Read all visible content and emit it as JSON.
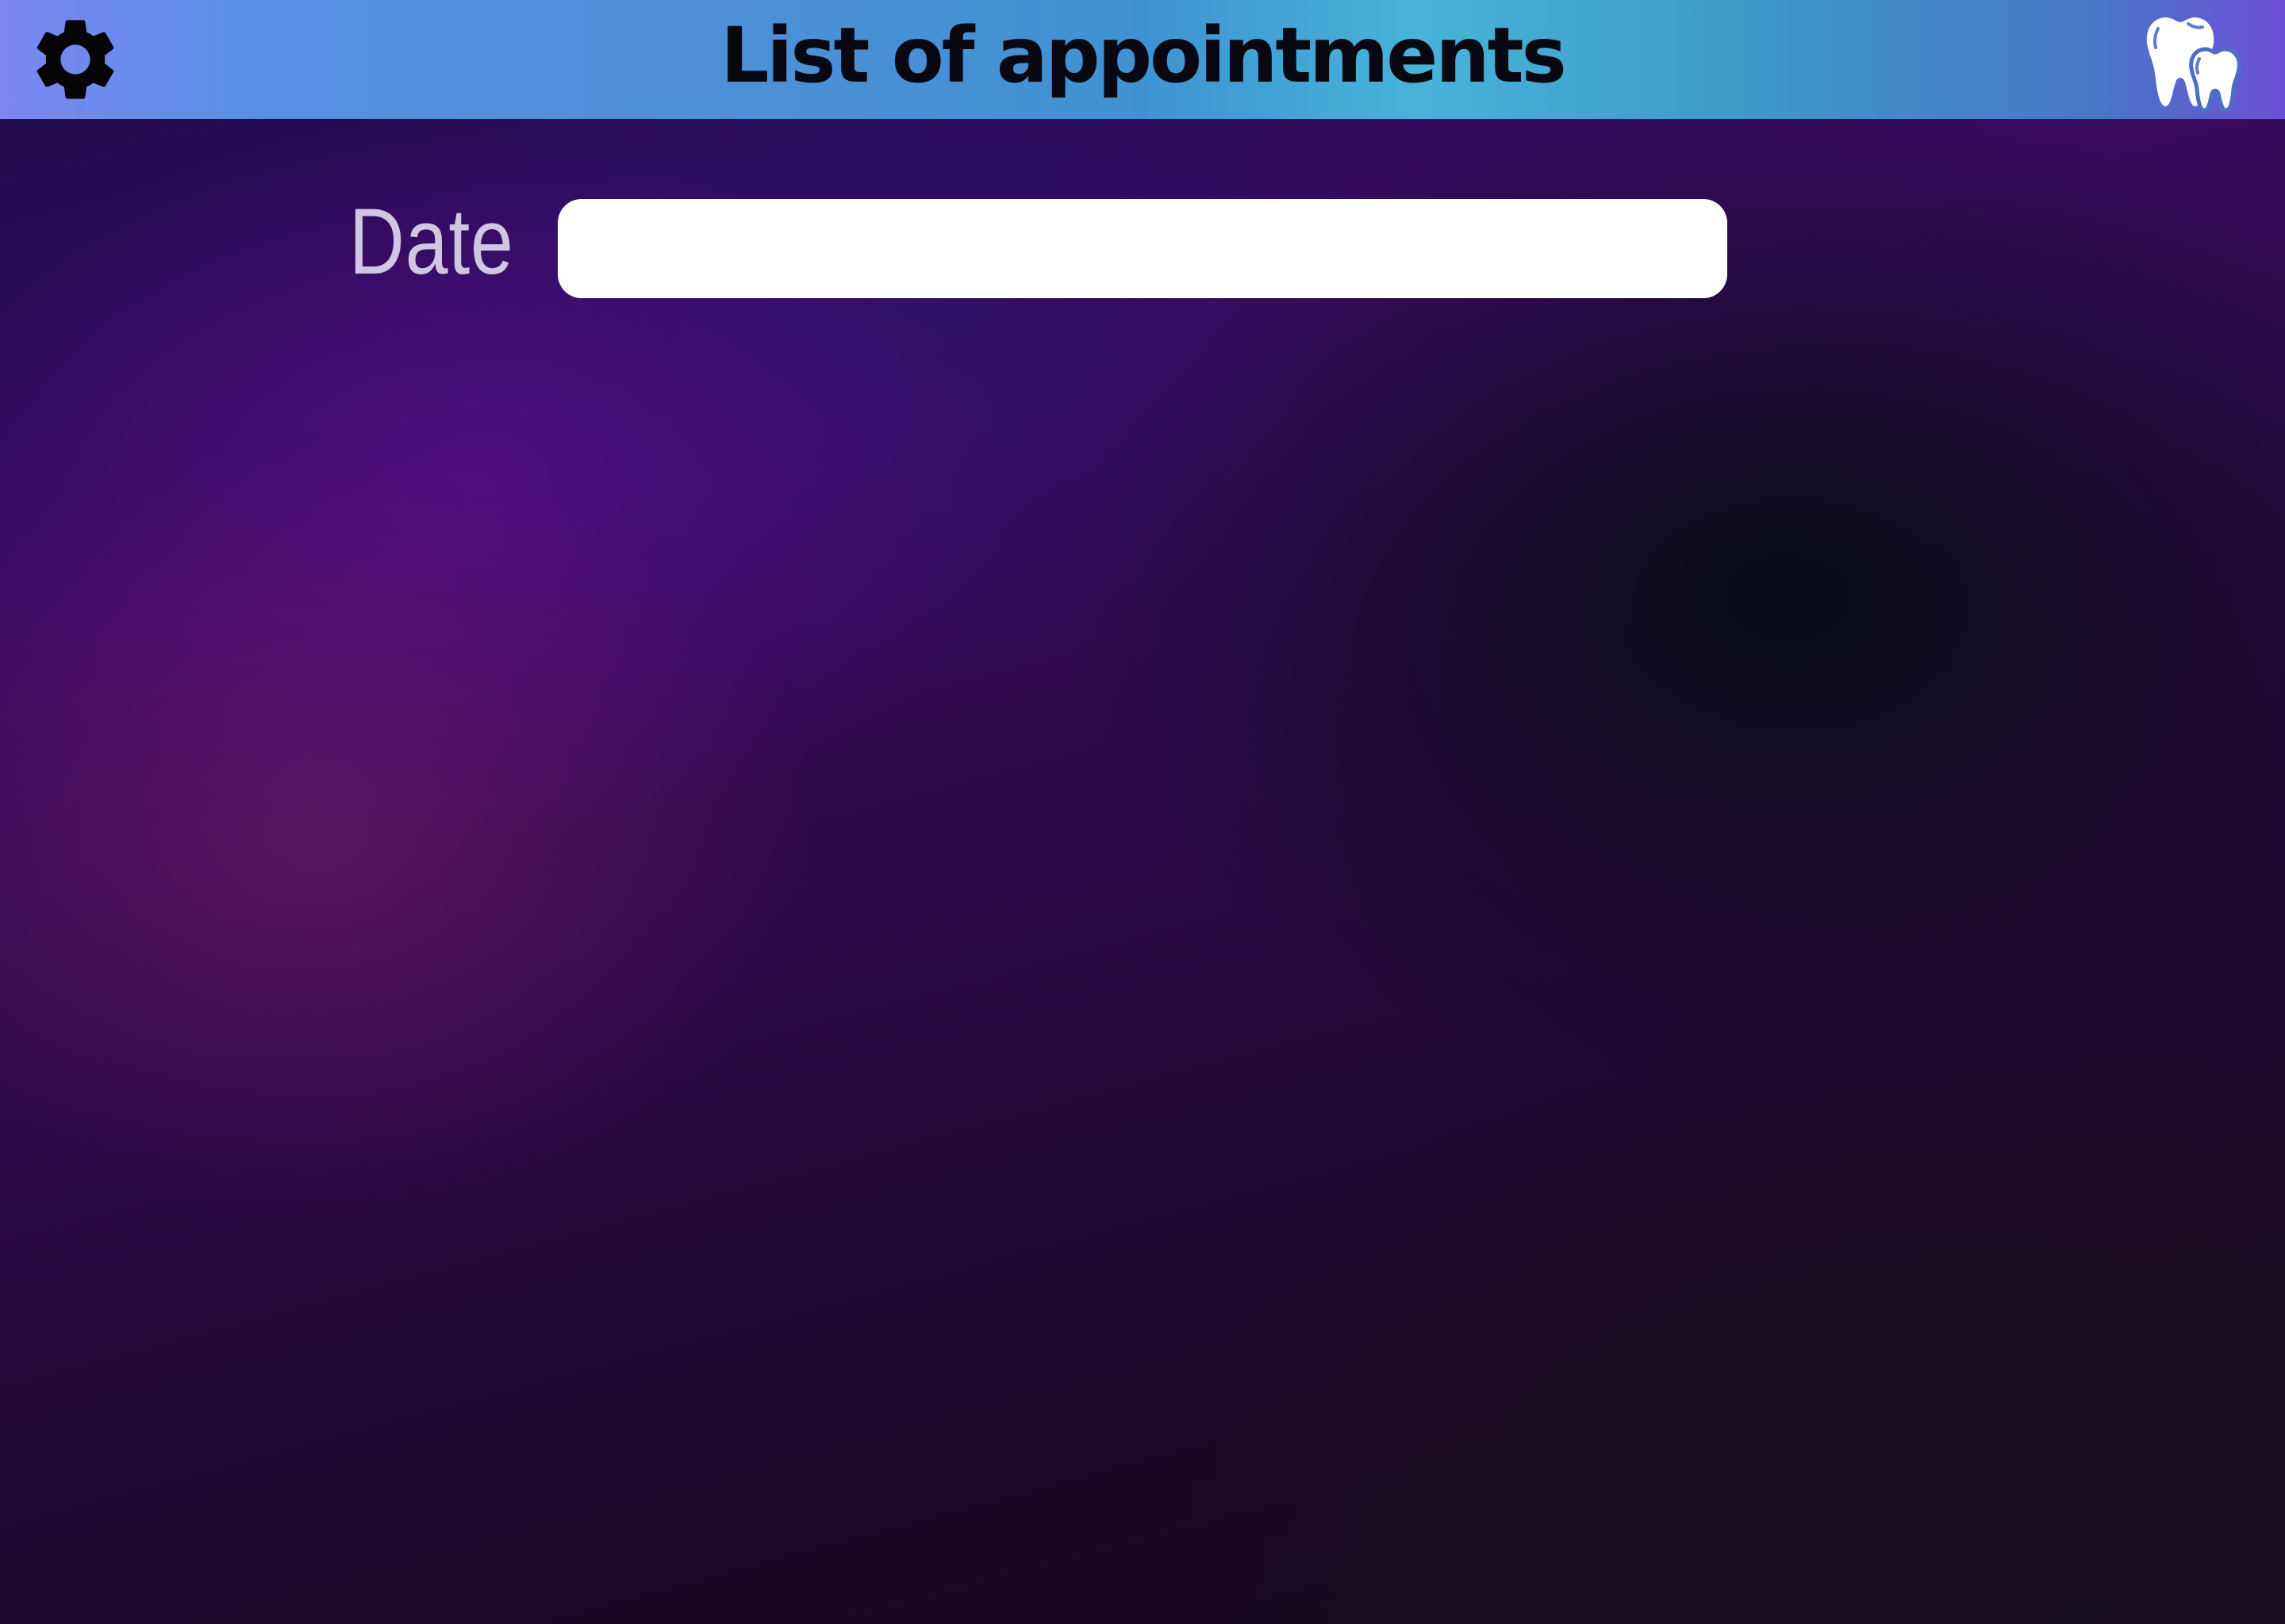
{
  "header": {
    "title": "List of appointments",
    "settings_icon": "gear-icon",
    "logo_icon": "teeth-icon"
  },
  "form": {
    "date_label": "Date",
    "date_value": "",
    "date_placeholder": ""
  },
  "colors": {
    "header_gradient_start": "#7d86f4",
    "header_gradient_mid": "#47b4d8",
    "header_gradient_end": "#6d4fd6",
    "title_text": "#080812",
    "label_text": "#d0c6e2",
    "input_background": "#ffffff"
  }
}
